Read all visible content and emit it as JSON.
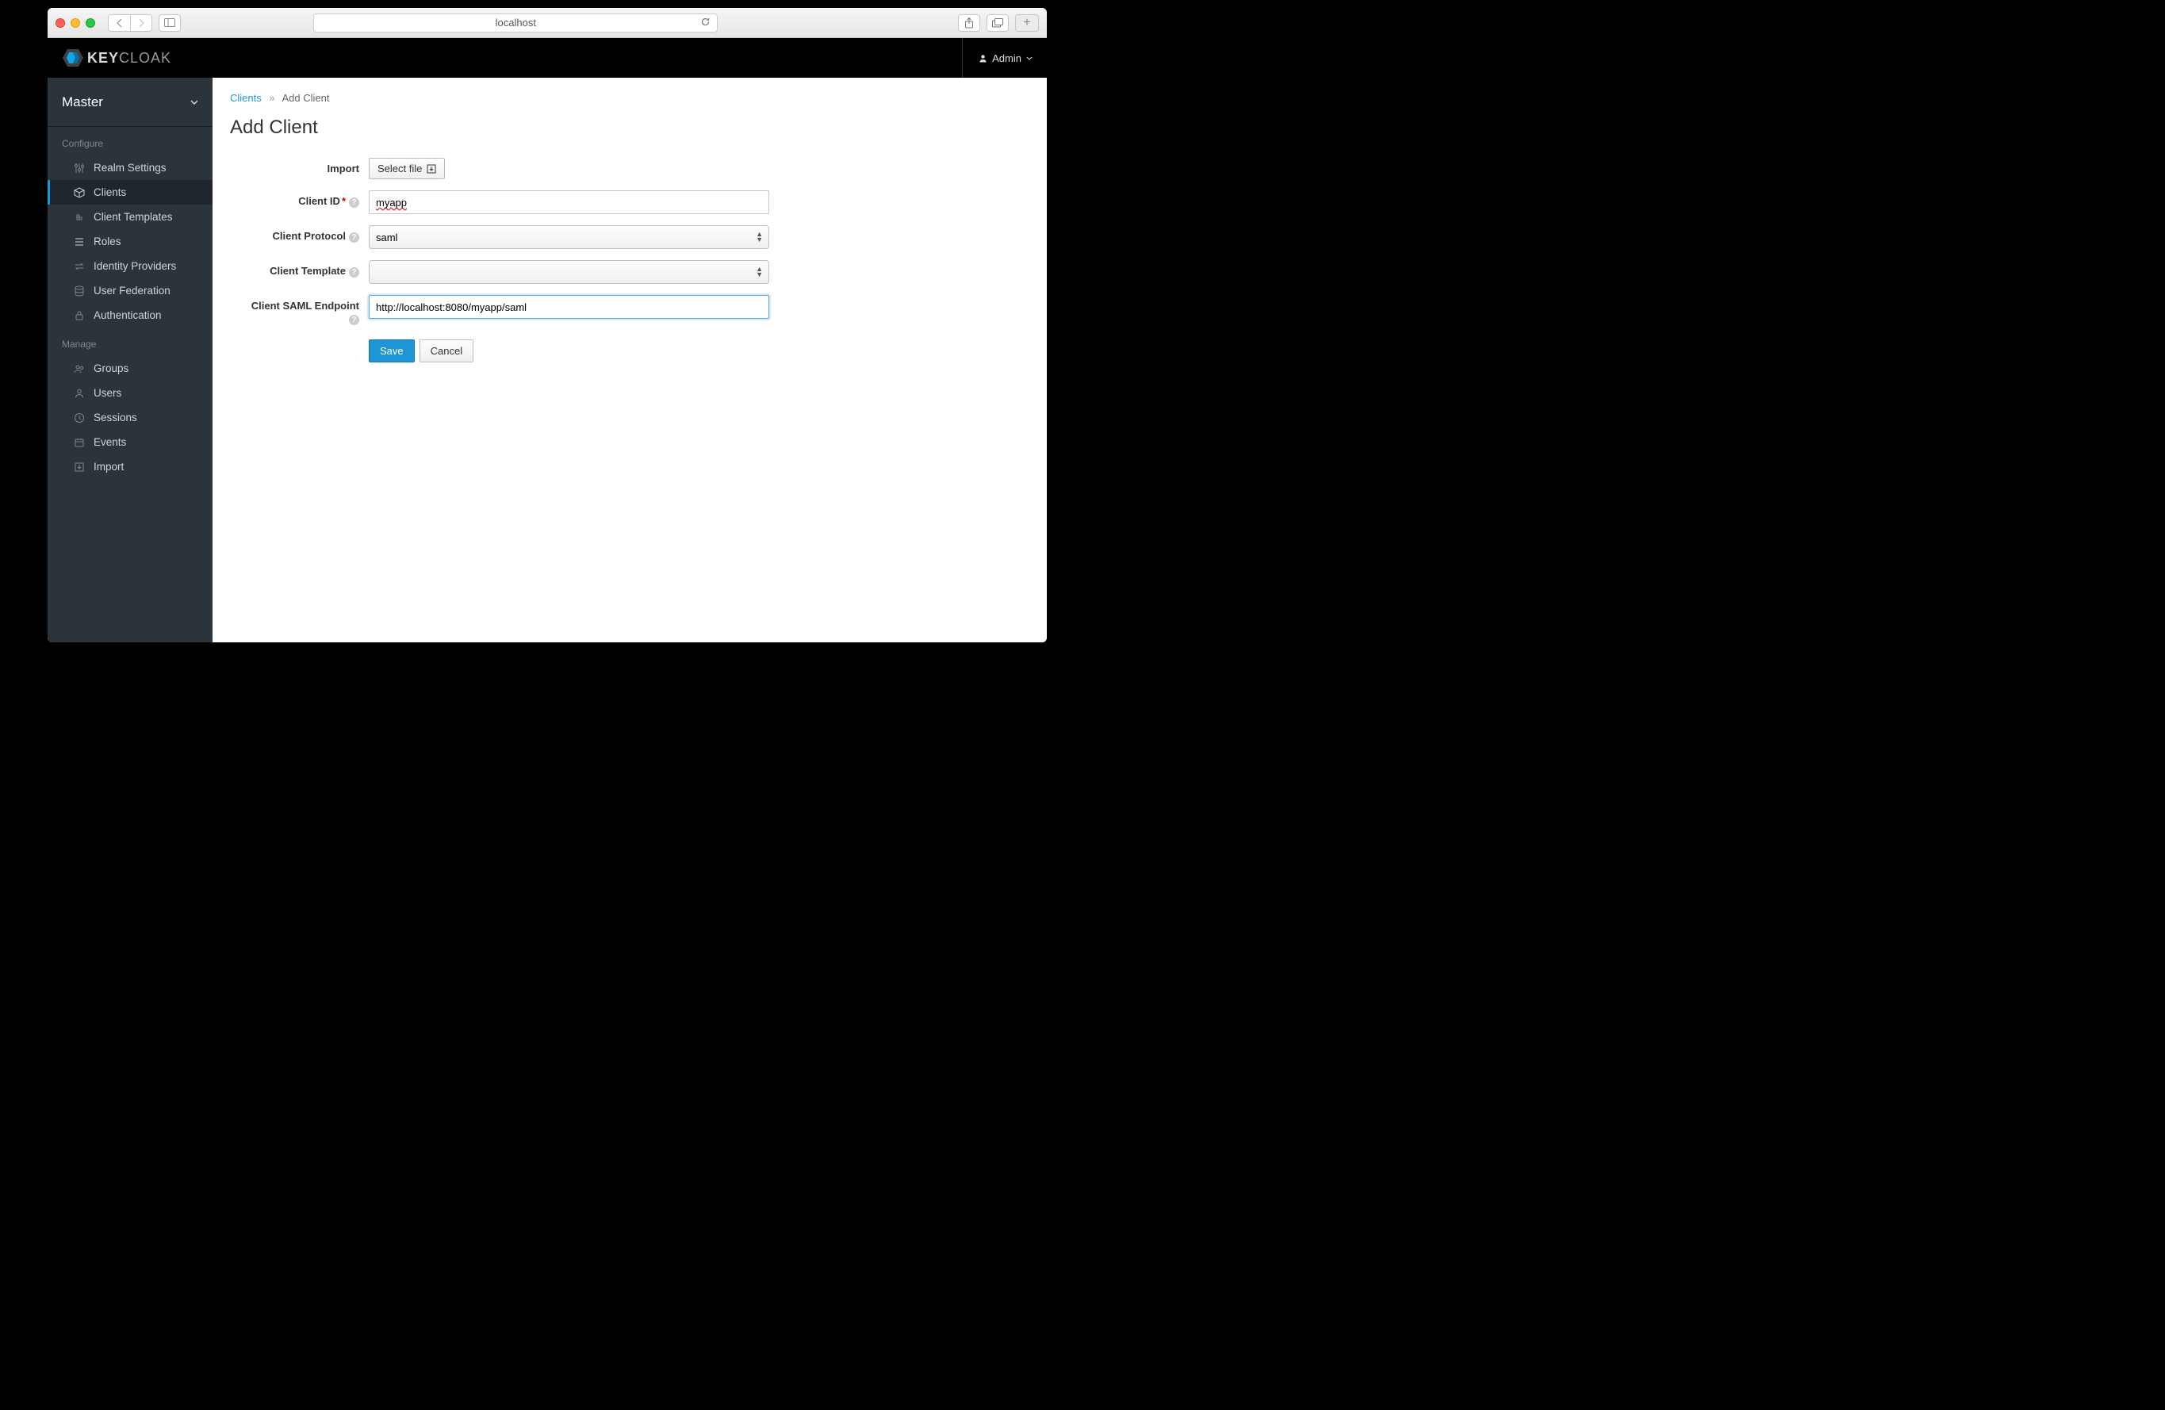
{
  "browser": {
    "address": "localhost"
  },
  "topbar": {
    "logo_main": "KEY",
    "logo_sub": "CLOAK",
    "user_label": "Admin"
  },
  "sidebar": {
    "realm": "Master",
    "configure_title": "Configure",
    "manage_title": "Manage",
    "configure": [
      {
        "label": "Realm Settings"
      },
      {
        "label": "Clients"
      },
      {
        "label": "Client Templates"
      },
      {
        "label": "Roles"
      },
      {
        "label": "Identity Providers"
      },
      {
        "label": "User Federation"
      },
      {
        "label": "Authentication"
      }
    ],
    "manage": [
      {
        "label": "Groups"
      },
      {
        "label": "Users"
      },
      {
        "label": "Sessions"
      },
      {
        "label": "Events"
      },
      {
        "label": "Import"
      }
    ]
  },
  "breadcrumb": {
    "root": "Clients",
    "current": "Add Client"
  },
  "page": {
    "title": "Add Client"
  },
  "form": {
    "import_label": "Import",
    "select_file": "Select file",
    "client_id_label": "Client ID",
    "client_id_value": "myapp",
    "client_protocol_label": "Client Protocol",
    "client_protocol_value": "saml",
    "client_template_label": "Client Template",
    "client_template_value": "",
    "client_saml_endpoint_label": "Client SAML Endpoint",
    "client_saml_endpoint_value": "http://localhost:8080/myapp/saml",
    "save": "Save",
    "cancel": "Cancel"
  }
}
